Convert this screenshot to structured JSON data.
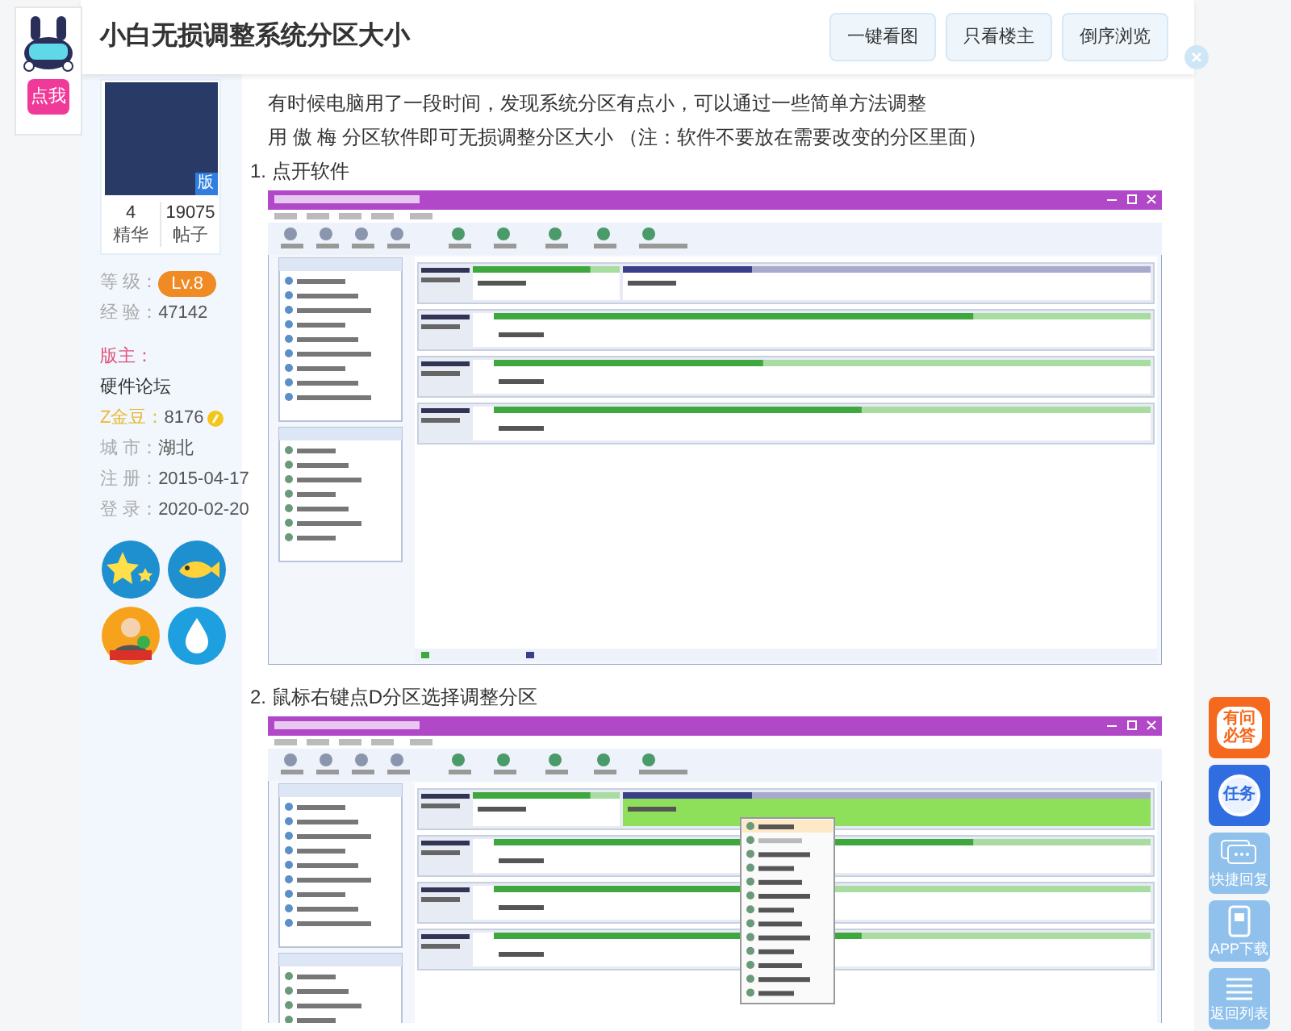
{
  "mascot": {
    "button": "点我"
  },
  "header": {
    "title": "小白无损调整系统分区大小",
    "buttons": [
      "一键看图",
      "只看楼主",
      "倒序浏览"
    ]
  },
  "author": {
    "moderator_badge": "版",
    "stats": [
      {
        "value": "4",
        "label": "精华"
      },
      {
        "value": "19075",
        "label": "帖子"
      }
    ],
    "rows": [
      {
        "kind": "level",
        "label": "等 级：",
        "value": "Lv.8"
      },
      {
        "kind": "text",
        "label": "经 验：",
        "value": "47142"
      },
      {
        "kind": "role",
        "label": "版主："
      },
      {
        "kind": "forum",
        "value": "硬件论坛"
      },
      {
        "kind": "coins",
        "label": "Z金豆：",
        "value": "8176"
      },
      {
        "kind": "text",
        "label": "城 市：",
        "value": "湖北"
      },
      {
        "kind": "text",
        "label": "注 册：",
        "value": "2015-04-17"
      },
      {
        "kind": "text",
        "label": "登 录：",
        "value": "2020-02-20"
      }
    ],
    "badges": [
      {
        "kind": "star"
      },
      {
        "kind": "fish"
      },
      {
        "kind": "person"
      },
      {
        "kind": "drop"
      }
    ]
  },
  "post": {
    "paragraphs": [
      "有时候电脑用了一段时间，发现系统分区有点小，可以通过一些简单方法调整",
      "用 傲 梅 分区软件即可无损调整分区大小 （注：软件不要放在需要改变的分区里面）"
    ],
    "steps": [
      {
        "label": "1. 点开软件",
        "screenshot": {
          "context_menu": false
        }
      },
      {
        "label": "2. 鼠标右键点D分区选择调整分区",
        "screenshot": {
          "context_menu": true
        }
      }
    ]
  },
  "float_buttons": [
    {
      "kind": "qa",
      "label": "有问必答"
    },
    {
      "kind": "task",
      "label": "任务"
    },
    {
      "kind": "reply",
      "label": "快捷回复"
    },
    {
      "kind": "app",
      "label": "APP下载"
    },
    {
      "kind": "list",
      "label": "返回列表"
    }
  ]
}
